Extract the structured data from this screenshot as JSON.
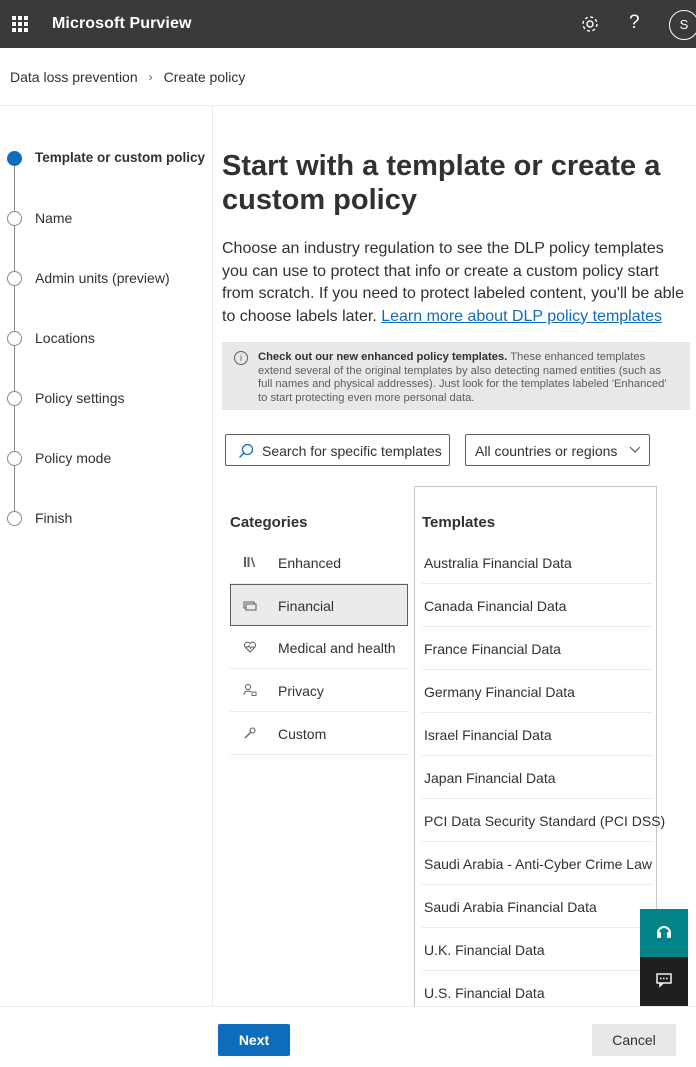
{
  "app": {
    "title": "Microsoft Purview",
    "user_initial": "S"
  },
  "breadcrumb": {
    "items": [
      "Data loss prevention",
      "Create policy"
    ]
  },
  "steps": [
    {
      "label": "Template or custom policy",
      "active": true
    },
    {
      "label": "Name"
    },
    {
      "label": "Admin units (preview)"
    },
    {
      "label": "Locations"
    },
    {
      "label": "Policy settings"
    },
    {
      "label": "Policy mode"
    },
    {
      "label": "Finish"
    }
  ],
  "main": {
    "title": "Start with a template or create a custom policy",
    "description": "Choose an industry regulation to see the DLP policy templates you can use to protect that info or create a custom policy start from scratch. If you need to protect labeled content, you'll be able to choose labels later.",
    "learn_more_link": "Learn more about DLP policy templates"
  },
  "banner": {
    "bold": "Check out our new enhanced policy templates.",
    "text": " These enhanced templates extend several of the original templates by also detecting named entities (such as full names and physical addresses). Just look for the templates labeled 'Enhanced' to start protecting even more personal data."
  },
  "search": {
    "placeholder": "Search for specific templates"
  },
  "region_dropdown": {
    "value": "All countries or regions"
  },
  "categories": {
    "header": "Categories",
    "items": [
      {
        "label": "Enhanced",
        "icon": "library-icon"
      },
      {
        "label": "Financial",
        "icon": "money-icon",
        "selected": true
      },
      {
        "label": "Medical and health",
        "icon": "heart-icon"
      },
      {
        "label": "Privacy",
        "icon": "person-lock-icon"
      },
      {
        "label": "Custom",
        "icon": "wrench-icon"
      }
    ]
  },
  "templates": {
    "header": "Templates",
    "items": [
      "Australia Financial Data",
      "Canada Financial Data",
      "France Financial Data",
      "Germany Financial Data",
      "Israel Financial Data",
      "Japan Financial Data",
      "PCI Data Security Standard (PCI DSS)",
      "Saudi Arabia - Anti-Cyber Crime Law",
      "Saudi Arabia Financial Data",
      "U.K. Financial Data",
      "U.S. Financial Data"
    ]
  },
  "footer": {
    "next_label": "Next",
    "cancel_label": "Cancel"
  },
  "colors": {
    "accent": "#0f6cbd",
    "topbar": "#3b3a39",
    "teal": "#038387"
  }
}
